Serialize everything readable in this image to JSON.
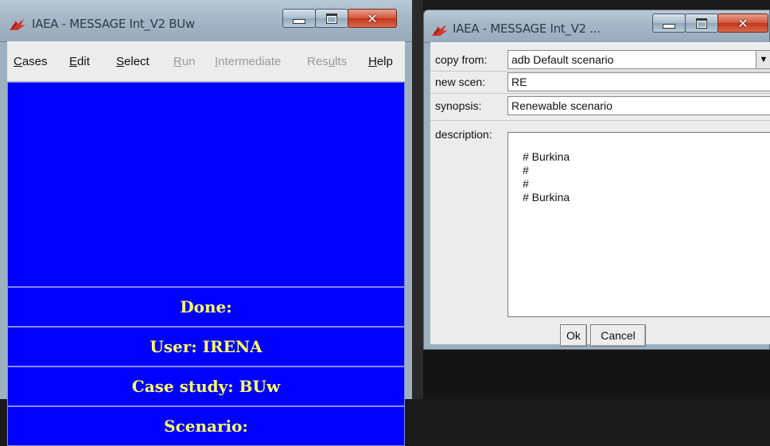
{
  "left_window": {
    "title": "IAEA - MESSAGE Int_V2 BUw",
    "menu": [
      {
        "label": "Cases",
        "mnemonic": "C",
        "rest": "ases",
        "disabled": false
      },
      {
        "label": "Edit",
        "mnemonic": "E",
        "rest": "dit",
        "disabled": false
      },
      {
        "label": "Select",
        "mnemonic": "S",
        "rest": "elect",
        "disabled": false
      },
      {
        "label": "Run",
        "mnemonic": "R",
        "rest": "un",
        "disabled": true
      },
      {
        "label": "Intermediate",
        "mnemonic": "I",
        "rest": "ntermediate",
        "disabled": true
      },
      {
        "label": "Results",
        "pre": "Res",
        "mnemonic": "u",
        "rest": "lts",
        "disabled": true
      },
      {
        "label": "Help",
        "mnemonic": "H",
        "rest": "elp",
        "disabled": false
      }
    ],
    "status": {
      "done": "Done:",
      "user": "User: IRENA",
      "case_study": "Case study: BUw",
      "scenario": "Scenario:"
    },
    "colors": {
      "panel_bg": "#0000FE",
      "status_text": "#FFFF66"
    }
  },
  "right_window": {
    "title": "IAEA - MESSAGE Int_V2 ...",
    "copy_from_label": "copy from:",
    "copy_from_value": "adb  Default scenario",
    "new_scen_label": "new scen:",
    "new_scen_value": "RE",
    "synopsis_label": "synopsis:",
    "synopsis_value": "Renewable scenario",
    "description_label": "description:",
    "description_lines": [
      "# Burkina",
      "#",
      "#",
      "# Burkina"
    ],
    "ok_label": "Ok",
    "cancel_label": "Cancel"
  },
  "icons": {
    "app": "tk-feather-icon",
    "minimize": "minimize-icon",
    "maximize": "maximize-icon",
    "close": "close-icon",
    "dropdown": "dropdown-arrow-icon"
  }
}
